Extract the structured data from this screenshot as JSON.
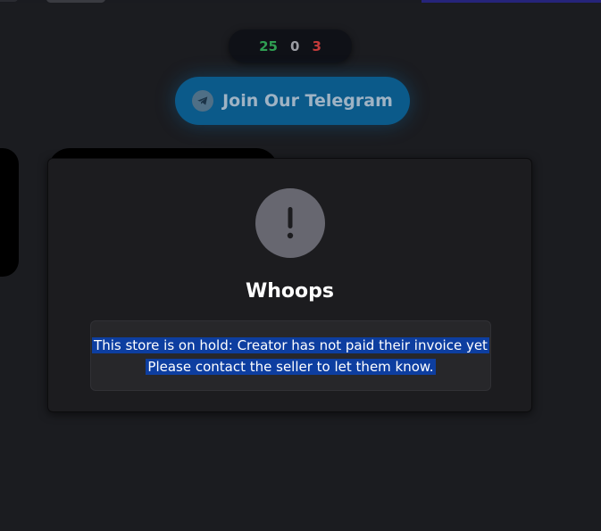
{
  "stats": {
    "green": "25",
    "gray": "0",
    "red": "3"
  },
  "telegram": {
    "label": "Join Our Telegram",
    "icon": "telegram-icon"
  },
  "modal": {
    "icon": "exclamation-icon",
    "title": "Whoops",
    "message_line1": "This store is on hold: Creator has not paid their invoice yet",
    "message_line2": "Please contact the seller to let them know."
  },
  "colors": {
    "background": "#1b1c20",
    "telegram_button": "#0b5a8a",
    "modal_background": "#1c1c1f",
    "alert_circle": "#676770",
    "text_selection": "#0d3ea0"
  }
}
